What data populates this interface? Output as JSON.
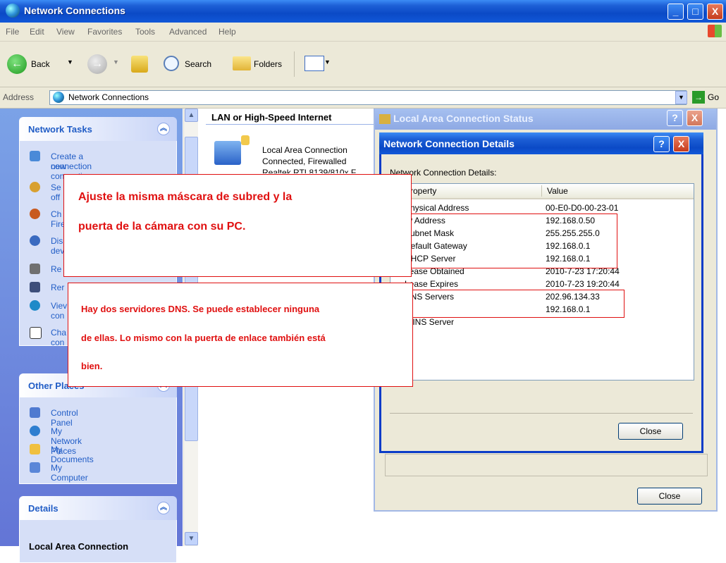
{
  "window": {
    "title": "Network Connections",
    "min": "_",
    "max": "□",
    "close": "X"
  },
  "menu": [
    "File",
    "Edit",
    "View",
    "Favorites",
    "Tools",
    "Advanced",
    "Help"
  ],
  "toolbar": {
    "back": "Back",
    "search": "Search",
    "folders": "Folders"
  },
  "address": {
    "label": "Address",
    "value": "Network Connections",
    "go": "Go"
  },
  "tasks": {
    "network_tasks": {
      "title": "Network Tasks",
      "items": [
        "Create a new connection",
        "Se",
        "Ch",
        "Dis",
        "Re",
        "Rer",
        "Viev",
        "Cha"
      ],
      "items_line2": [
        "connection",
        "off",
        "Fire",
        "dev",
        "",
        "",
        "con",
        "con"
      ]
    },
    "other_places": {
      "title": "Other Places",
      "items": [
        "Control Panel",
        "My Network Places",
        "My Documents",
        "My Computer"
      ]
    },
    "details": {
      "title": "Details",
      "subtitle": "Local Area Connection"
    }
  },
  "content": {
    "group_header": "LAN or High-Speed Internet",
    "connection": {
      "name": "Local Area Connection",
      "status": "Connected, Firewalled",
      "device": "Realtek RTL8139/810x F"
    }
  },
  "status_dialog": {
    "title": "Local Area Connection Status",
    "help": "?",
    "close": "X",
    "close_button": "Close"
  },
  "details_dialog": {
    "title": "Network Connection Details",
    "help": "?",
    "close": "X",
    "label": "Network Connection Details:",
    "columns": [
      "Property",
      "Value"
    ],
    "rows": [
      [
        "Physical Address",
        "00-E0-D0-00-23-01"
      ],
      [
        "IP Address",
        "192.168.0.50"
      ],
      [
        "Subnet Mask",
        "255.255.255.0"
      ],
      [
        "Default Gateway",
        "192.168.0.1"
      ],
      [
        "DHCP Server",
        "192.168.0.1"
      ],
      [
        "Lease Obtained",
        "2010-7-23 17:20:44"
      ],
      [
        "Lease Expires",
        "2010-7-23 19:20:44"
      ],
      [
        "DNS Servers",
        "202.96.134.33"
      ],
      [
        "",
        "192.168.0.1"
      ],
      [
        "WINS Server",
        ""
      ]
    ],
    "close_button": "Close"
  },
  "annotations": {
    "subnet_note_line1": "Ajuste la misma máscara de subred y la",
    "subnet_note_line2": "puerta de la cámara con su PC.",
    "dns_note_line1": "Hay dos servidores DNS. Se puede establecer ninguna",
    "dns_note_line2": "de ellas. Lo mismo con la puerta de enlace también está",
    "dns_note_line3": "bien."
  },
  "colors": {
    "xp_blue": "#0b4ac6",
    "annotation_red": "#e01010",
    "task_link": "#215dc6"
  }
}
